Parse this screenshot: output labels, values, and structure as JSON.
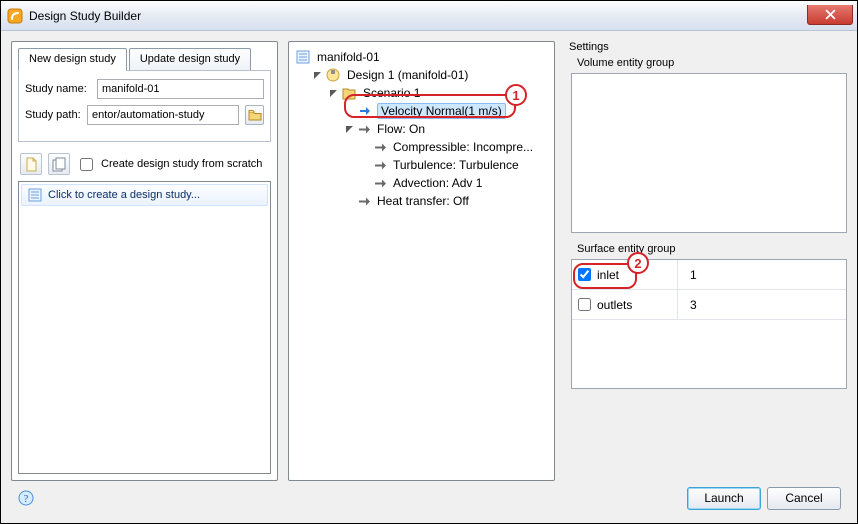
{
  "window": {
    "title": "Design Study Builder"
  },
  "left": {
    "tabs": [
      "New design study",
      "Update design study"
    ],
    "active_tab": 0,
    "study_name_label": "Study name:",
    "study_name_value": "manifold-01",
    "study_path_label": "Study path:",
    "study_path_value": "entor/automation-study",
    "scratch_label": "Create design study from scratch",
    "scratch_checked": false,
    "list_prompt": "Click to create a design study..."
  },
  "tree": {
    "root": "manifold-01",
    "design": "Design 1 (manifold-01)",
    "scenario": "Scenario 1",
    "velocity": "Velocity Normal(1 m/s)",
    "flow": "Flow: On",
    "compressible": "Compressible: Incompre...",
    "turbulence": "Turbulence: Turbulence",
    "advection": "Advection: Adv 1",
    "heat": "Heat transfer: Off"
  },
  "settings": {
    "title": "Settings",
    "volume_title": "Volume entity group",
    "surface_title": "Surface entity group",
    "rows": [
      {
        "name": "inlet",
        "checked": true,
        "value": "1"
      },
      {
        "name": "outlets",
        "checked": false,
        "value": "3"
      }
    ]
  },
  "footer": {
    "launch": "Launch",
    "cancel": "Cancel"
  },
  "annotations": {
    "one": "1",
    "two": "2"
  }
}
